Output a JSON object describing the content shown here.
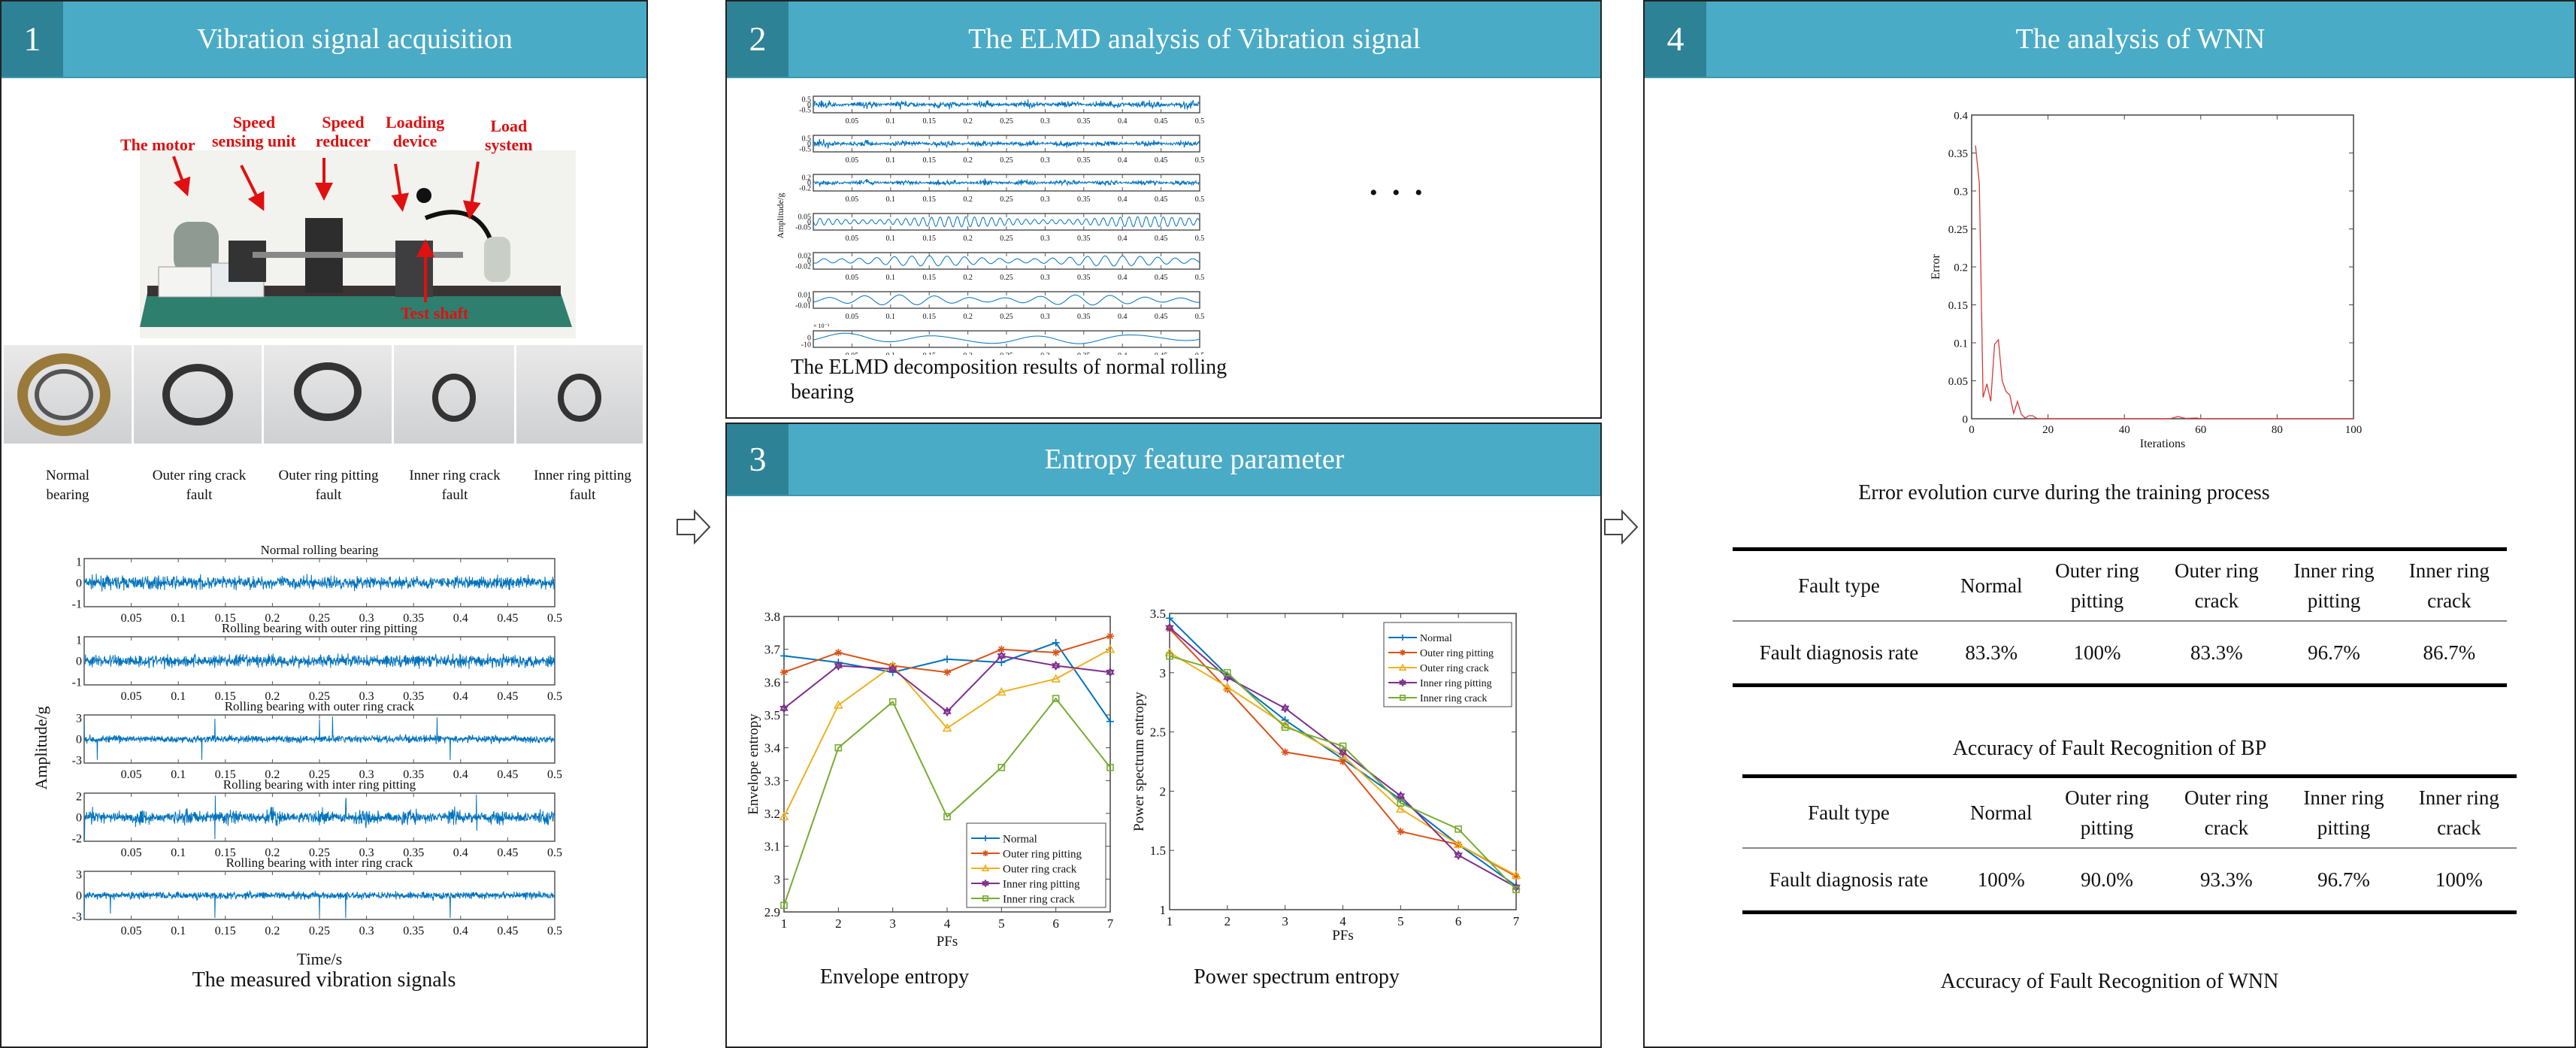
{
  "colors": {
    "header": "#4aabc6",
    "header_number": "#2e8296",
    "label_red": "#e01010",
    "signal_blue": "#0072bd",
    "error_red": "#d9383a"
  },
  "panel1": {
    "number": "1",
    "title": "Vibration signal acquisition",
    "rig_labels": {
      "motor": "The motor",
      "speed_sensing": "Speed\nsensing unit",
      "reducer": "Speed\nreducer",
      "loading": "Loading\ndevice",
      "load_system": "Load\nsystem",
      "test_shaft": "Test shaft"
    },
    "bearings": [
      "Normal\nbearing",
      "Outer ring crack\nfault",
      "Outer ring pitting\nfault",
      "Inner ring crack\nfault",
      "Inner ring pitting\nfault"
    ],
    "caption": "The measured vibration signals"
  },
  "panel2": {
    "number": "2",
    "title": "The ELMD analysis of Vibration signal",
    "caption": "The ELMD decomposition results of normal rolling\nbearing",
    "ellipsis": "• • •"
  },
  "panel3": {
    "number": "3",
    "title": "Entropy feature parameter",
    "caption_left": "Envelope entropy",
    "caption_right": "Power spectrum entropy"
  },
  "panel4": {
    "number": "4",
    "title": "The analysis of WNN",
    "error_caption": "Error evolution curve during the training process",
    "table_bp": {
      "caption": "Accuracy of Fault Recognition of BP",
      "headers": [
        "Fault type",
        "Normal",
        "Outer ring\npitting",
        "Outer ring\ncrack",
        "Inner ring\npitting",
        "Inner ring\ncrack"
      ],
      "row": [
        "Fault diagnosis rate",
        "83.3%",
        "100%",
        "83.3%",
        "96.7%",
        "86.7%"
      ]
    },
    "table_wnn": {
      "caption": "Accuracy of Fault Recognition of WNN",
      "headers": [
        "Fault type",
        "Normal",
        "Outer ring\npitting",
        "Outer ring\ncrack",
        "Inner ring\npitting",
        "Inner ring\ncrack"
      ],
      "row": [
        "Fault diagnosis rate",
        "100%",
        "90.0%",
        "93.3%",
        "96.7%",
        "100%"
      ]
    }
  },
  "chart_data": [
    {
      "id": "vibration",
      "type": "line",
      "ylabel": "Amplitude/g",
      "xlabel": "Time/s",
      "xlim": [
        0,
        0.5
      ],
      "xticks": [
        "0.05",
        "0.1",
        "0.15",
        "0.2",
        "0.25",
        "0.3",
        "0.35",
        "0.4",
        "0.45",
        "0.5"
      ],
      "subplots": [
        {
          "title": "Normal rolling bearing",
          "yticks": [
            "1",
            "0",
            "-1"
          ]
        },
        {
          "title": "Rolling bearing with outer ring pitting",
          "yticks": [
            "1",
            "0",
            "-1"
          ]
        },
        {
          "title": "Rolling bearing with outer ring crack",
          "yticks": [
            "3",
            "0",
            "-3"
          ]
        },
        {
          "title": "Rolling bearing with inter ring pitting",
          "yticks": [
            "2",
            "0",
            "-2"
          ]
        },
        {
          "title": "Rolling bearing with inter ring crack",
          "yticks": [
            "3",
            "0",
            "-3"
          ]
        }
      ]
    },
    {
      "id": "elmd",
      "type": "line",
      "ylabel": "Amplitude/g",
      "xlim": [
        0,
        0.5
      ],
      "xticks": [
        "0.05",
        "0.1",
        "0.15",
        "0.2",
        "0.25",
        "0.3",
        "0.35",
        "0.4",
        "0.45",
        "0.5"
      ],
      "subplots": [
        {
          "yticks": [
            "0.5",
            "0",
            "-0.5"
          ]
        },
        {
          "yticks": [
            "0.5",
            "0",
            "-0.5"
          ]
        },
        {
          "yticks": [
            "0.2",
            "0",
            "-0.2"
          ]
        },
        {
          "yticks": [
            "0.05",
            "0",
            "-0.05"
          ]
        },
        {
          "yticks": [
            "0.02",
            "0",
            "-0.02"
          ]
        },
        {
          "yticks": [
            "0.01",
            "0",
            "-0.01"
          ]
        },
        {
          "yticks": [
            "0",
            "-10"
          ],
          "multiplier": "× 10⁻³"
        }
      ]
    },
    {
      "id": "envelope",
      "type": "line",
      "xlabel": "PFs",
      "ylabel": "Envelope entropy",
      "x": [
        1,
        2,
        3,
        4,
        5,
        6,
        7
      ],
      "ylim": [
        2.9,
        3.8
      ],
      "yticks": [
        "2.9",
        "3",
        "3.1",
        "3.2",
        "3.3",
        "3.4",
        "3.5",
        "3.6",
        "3.7",
        "3.8"
      ],
      "legend": "bottom-right",
      "series": [
        {
          "name": "Normal",
          "color": "#0072bd",
          "marker": "plus",
          "values": [
            3.68,
            3.66,
            3.63,
            3.67,
            3.66,
            3.72,
            3.48
          ]
        },
        {
          "name": "Outer ring pitting",
          "color": "#d95319",
          "marker": "asterisk",
          "values": [
            3.63,
            3.69,
            3.65,
            3.63,
            3.7,
            3.69,
            3.74
          ]
        },
        {
          "name": "Outer ring crack",
          "color": "#edb120",
          "marker": "triangle",
          "values": [
            3.19,
            3.53,
            3.65,
            3.46,
            3.57,
            3.61,
            3.7
          ]
        },
        {
          "name": "Inner ring pitting",
          "color": "#7e2f8e",
          "marker": "hexagram",
          "values": [
            3.52,
            3.65,
            3.64,
            3.51,
            3.68,
            3.65,
            3.63
          ]
        },
        {
          "name": "Inner ring crack",
          "color": "#77ac30",
          "marker": "square",
          "values": [
            2.92,
            3.4,
            3.54,
            3.19,
            3.34,
            3.55,
            3.34
          ]
        }
      ]
    },
    {
      "id": "power",
      "type": "line",
      "xlabel": "PFs",
      "ylabel": "Power spectrum entropy",
      "x": [
        1,
        2,
        3,
        4,
        5,
        6,
        7
      ],
      "ylim": [
        1,
        3.5
      ],
      "yticks": [
        "1",
        "1.5",
        "2",
        "2.5",
        "3",
        "3.5"
      ],
      "legend": "top-right",
      "series": [
        {
          "name": "Normal",
          "color": "#0072bd",
          "marker": "plus",
          "values": [
            3.46,
            2.98,
            2.6,
            2.27,
            1.93,
            1.55,
            1.2
          ]
        },
        {
          "name": "Outer ring pitting",
          "color": "#d95319",
          "marker": "asterisk",
          "values": [
            3.37,
            2.86,
            2.33,
            2.25,
            1.66,
            1.55,
            1.28
          ]
        },
        {
          "name": "Outer ring crack",
          "color": "#edb120",
          "marker": "triangle",
          "values": [
            3.17,
            2.88,
            2.56,
            2.3,
            1.85,
            1.55,
            1.29
          ]
        },
        {
          "name": "Inner ring pitting",
          "color": "#7e2f8e",
          "marker": "hexagram",
          "values": [
            3.38,
            2.96,
            2.7,
            2.33,
            1.96,
            1.46,
            1.19
          ]
        },
        {
          "name": "Inner ring crack",
          "color": "#77ac30",
          "marker": "square",
          "values": [
            3.14,
            3.0,
            2.54,
            2.38,
            1.9,
            1.68,
            1.17
          ]
        }
      ]
    },
    {
      "id": "error",
      "type": "line",
      "xlabel": "Iterations",
      "ylabel": "Error",
      "xlim": [
        0,
        100
      ],
      "ylim": [
        0,
        0.4
      ],
      "xticks": [
        "0",
        "20",
        "40",
        "60",
        "80",
        "100"
      ],
      "yticks": [
        "0",
        "0.05",
        "0.1",
        "0.15",
        "0.2",
        "0.25",
        "0.3",
        "0.35",
        "0.4"
      ],
      "series": [
        {
          "color": "#d9383a",
          "points": [
            [
              1,
              0.36
            ],
            [
              2,
              0.31
            ],
            [
              3,
              0.028
            ],
            [
              4,
              0.046
            ],
            [
              5,
              0.023
            ],
            [
              6,
              0.098
            ],
            [
              7,
              0.104
            ],
            [
              8,
              0.05
            ],
            [
              9,
              0.036
            ],
            [
              10,
              0.031
            ],
            [
              11,
              0.007
            ],
            [
              12,
              0.023
            ],
            [
              13,
              0.006
            ],
            [
              14,
              0.001
            ],
            [
              15,
              0.004
            ],
            [
              16,
              0.004
            ],
            [
              17,
              0.0005
            ],
            [
              18,
              0
            ],
            [
              52,
              0
            ],
            [
              54,
              0.003
            ],
            [
              56,
              0.0005
            ],
            [
              59,
              0.001
            ],
            [
              60,
              0
            ],
            [
              100,
              0
            ]
          ]
        }
      ]
    }
  ]
}
